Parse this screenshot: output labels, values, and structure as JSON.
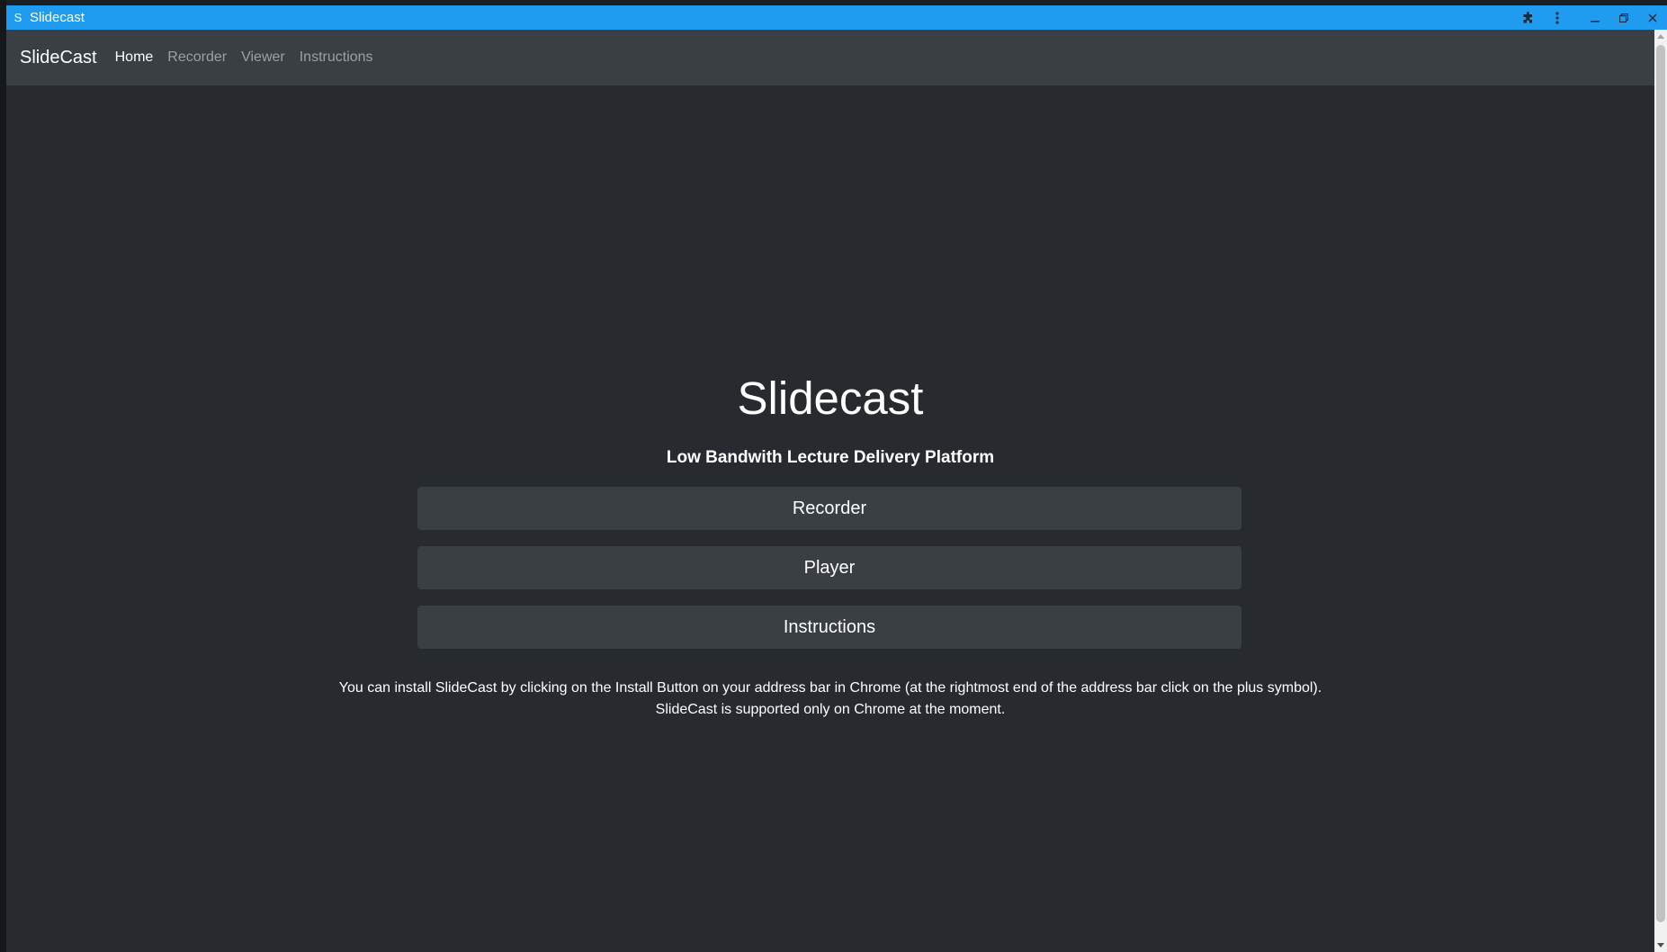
{
  "window": {
    "icon_letter": "S",
    "title": "Slidecast"
  },
  "titlebar_icons": [
    "puzzle-icon",
    "kebab-menu-icon",
    "minimize-icon",
    "restore-icon",
    "close-icon"
  ],
  "navbar": {
    "brand": "SlideCast",
    "links": [
      {
        "label": "Home",
        "active": true
      },
      {
        "label": "Recorder",
        "active": false
      },
      {
        "label": "Viewer",
        "active": false
      },
      {
        "label": "Instructions",
        "active": false
      }
    ]
  },
  "hero": {
    "title": "Slidecast",
    "subtitle": "Low Bandwith Lecture Delivery Platform"
  },
  "buttons": {
    "recorder": "Recorder",
    "player": "Player",
    "instructions": "Instructions"
  },
  "install_note": {
    "line1": "You can install SlideCast by clicking on the Install Button on your address bar in Chrome (at the rightmost end of the address bar click on the plus symbol).",
    "line2": "SlideCast is supported only on Chrome at the moment."
  },
  "colors": {
    "titlebar": "#1f9bf0",
    "navbar": "#3a3f44",
    "background": "#272b30",
    "button": "#3a3f44",
    "text": "#ffffff",
    "nav_inactive": "#9aa0a6"
  }
}
